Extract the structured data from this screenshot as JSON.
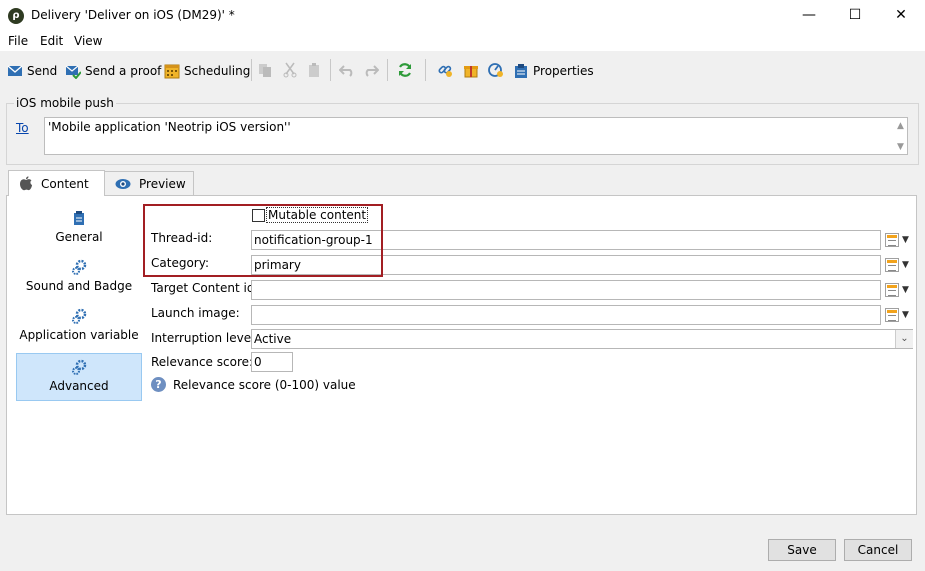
{
  "window": {
    "title": "Delivery 'Deliver on iOS (DM29)' *",
    "minimize": "—",
    "maximize": "☐",
    "close": "✕"
  },
  "menu": {
    "items": [
      "File",
      "Edit",
      "View"
    ]
  },
  "toolbar": {
    "send": "Send",
    "send_proof": "Send a proof",
    "scheduling": "Scheduling",
    "properties": "Properties"
  },
  "recipients": {
    "group_title": "iOS mobile push",
    "to_label": "To",
    "to_value": "'Mobile application 'Neotrip iOS version''"
  },
  "tabs": [
    {
      "label": "Content",
      "icon": "apple-icon",
      "active": true
    },
    {
      "label": "Preview",
      "icon": "eye-icon",
      "active": false
    }
  ],
  "sidenav": [
    {
      "label": "General",
      "icon": "clipboard-icon",
      "selected": false
    },
    {
      "label": "Sound and Badge",
      "icon": "gears-icon",
      "selected": false
    },
    {
      "label": "Application variable",
      "icon": "gears-icon",
      "selected": false
    },
    {
      "label": "Advanced",
      "icon": "gears-icon",
      "selected": true
    }
  ],
  "form": {
    "mutable_content_label": "Mutable content",
    "mutable_content_checked": false,
    "thread_id_label": "Thread-id:",
    "thread_id_value": "notification-group-1",
    "category_label": "Category:",
    "category_value": "primary",
    "target_content_label": "Target Content id:",
    "target_content_value": "",
    "launch_image_label": "Launch image:",
    "launch_image_value": "",
    "interruption_label": "Interruption level:",
    "interruption_value": "Active",
    "relevance_label": "Relevance score:",
    "relevance_value": "0",
    "relevance_help": "Relevance score (0-100) value"
  },
  "footer": {
    "save": "Save",
    "cancel": "Cancel"
  },
  "colors": {
    "highlight": "#a21e23",
    "selected_nav": "#cfe6fb",
    "link": "#0645ad"
  }
}
